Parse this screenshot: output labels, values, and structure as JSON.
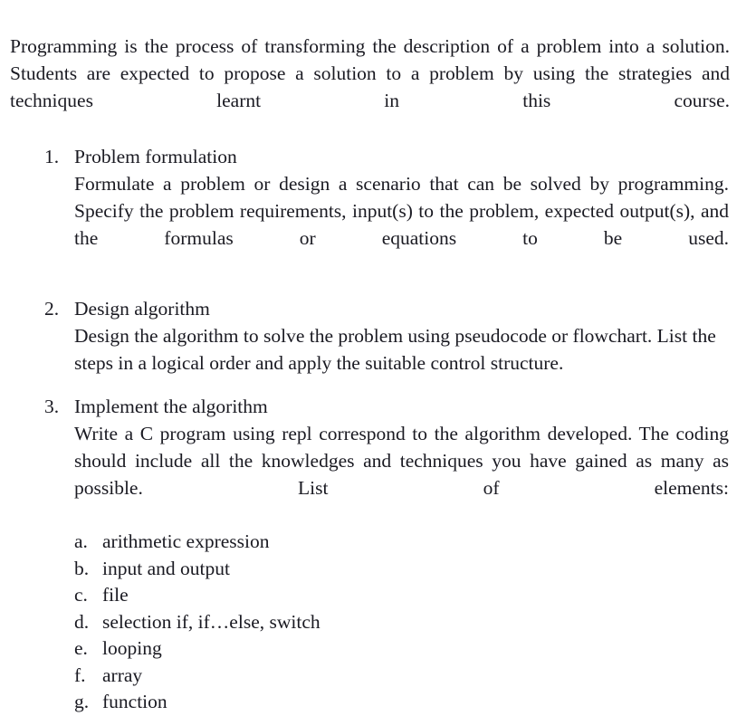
{
  "document": {
    "intro_paragraph": "Programming is the process of transforming the description of a problem into a solution. Students are expected to propose a solution to a problem by using the strategies and techniques learnt in this course.",
    "items": [
      {
        "marker": "1.",
        "title": "Problem formulation",
        "body": "Formulate a problem or design a scenario that can be solved by programming. Specify the problem requirements, input(s) to the problem, expected output(s), and the formulas or equations to be used."
      },
      {
        "marker": "2.",
        "title": "Design algorithm",
        "body": "Design the algorithm to solve the problem using pseudocode or flowchart. List the steps in a logical order and apply the suitable control structure."
      },
      {
        "marker": "3.",
        "title": "Implement the algorithm",
        "body": "Write a C program using repl correspond to the algorithm developed. The coding should include all the knowledges and techniques you have gained as many as possible. List of elements:",
        "sub_items": [
          {
            "marker": "a.",
            "text": "arithmetic expression"
          },
          {
            "marker": "b.",
            "text": "input and output"
          },
          {
            "marker": "c.",
            "text": "file"
          },
          {
            "marker": "d.",
            "text": "selection if, if…else, switch"
          },
          {
            "marker": "e.",
            "text": "looping"
          },
          {
            "marker": "f.",
            "text": "array"
          },
          {
            "marker": "g.",
            "text": "function"
          }
        ]
      }
    ]
  },
  "style": {
    "background_color": "#ffffff",
    "text_color": "#1a1a22"
  }
}
